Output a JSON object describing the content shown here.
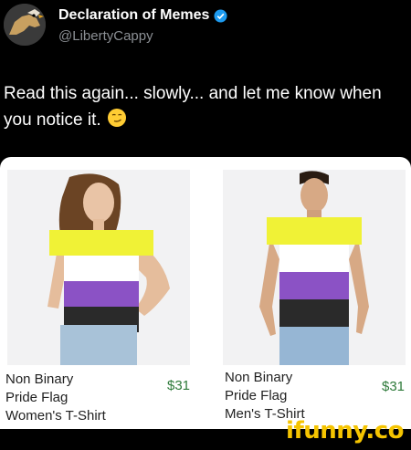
{
  "author": {
    "display_name": "Declaration of Memes",
    "handle": "@LibertyCappy"
  },
  "tweet": {
    "text": "Read this again... slowly... and let me know when you notice it.",
    "emoji": "smirking-face"
  },
  "products": [
    {
      "title_line1": "Non Binary",
      "title_line2": "Pride Flag",
      "title_line3": "Women's T-Shirt",
      "price": "$31",
      "shirt_colors": [
        "#f0f236",
        "#ffffff",
        "#8b52c5",
        "#2a2a2a"
      ]
    },
    {
      "title_line1": "Non Binary",
      "title_line2": "Pride Flag",
      "title_line3": "Men's T-Shirt",
      "price": "$31",
      "shirt_colors": [
        "#f0f236",
        "#ffffff",
        "#8b52c5",
        "#2a2a2a"
      ]
    }
  ],
  "watermark": "ifunny.co",
  "colors": {
    "background": "#000000",
    "handle": "#8b8f94",
    "price": "#2e7a3a",
    "verified": "#1d9bf0",
    "watermark": "#f5c400"
  }
}
